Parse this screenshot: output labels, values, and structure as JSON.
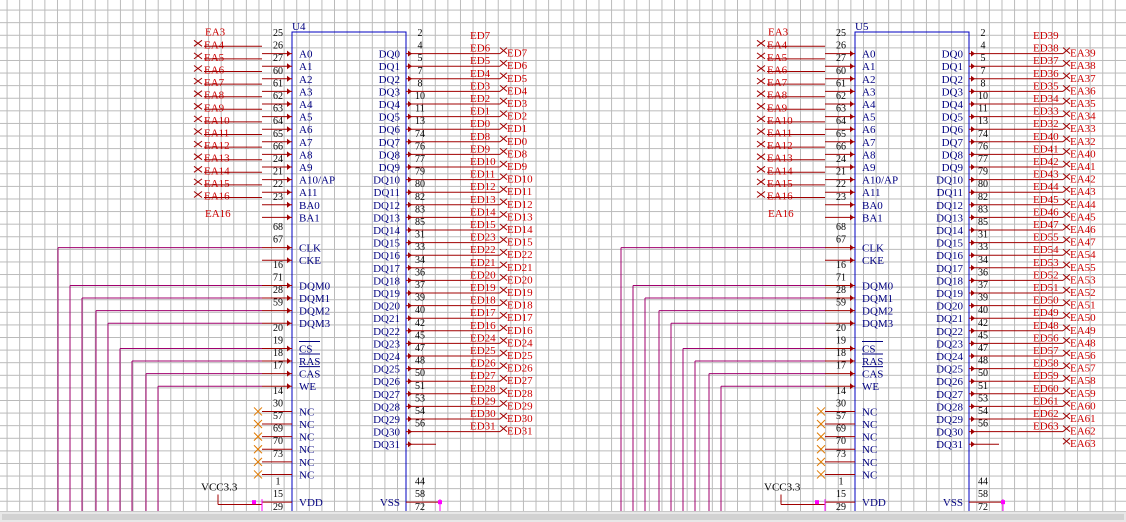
{
  "view": {
    "grid": true,
    "background": "#ffffff",
    "grid_color": "#b9b9b9"
  },
  "colors": {
    "wire": "#a00000",
    "label": "#cc0000",
    "body": "#0000c0",
    "pin_text": "#000080",
    "clock_wire": "#a0006e",
    "nc_mark": "#e07a00",
    "power_pin": "#ff00ff"
  },
  "power_label": "VCC3.3",
  "chips": [
    {
      "ref": "U4",
      "addr_nets": [
        "EA3",
        "EA4",
        "EA5",
        "EA6",
        "EA7",
        "EA8",
        "EA9",
        "EA10",
        "EA11",
        "EA12",
        "EA13",
        "EA14",
        "EA15",
        "EA16"
      ],
      "addr_extra_label": "EA16",
      "data_nets": [
        "ED7",
        "ED6",
        "ED5",
        "ED4",
        "ED3",
        "ED2",
        "ED1",
        "ED0",
        "ED8",
        "ED9",
        "ED10",
        "ED11",
        "ED12",
        "ED13",
        "ED14",
        "ED15",
        "ED23",
        "ED22",
        "ED21",
        "ED20",
        "ED19",
        "ED18",
        "ED17",
        "ED16",
        "ED24",
        "ED25",
        "ED26",
        "ED27",
        "ED28",
        "ED29",
        "ED30",
        "ED31"
      ],
      "data_side_labels": [
        "ED7",
        "ED6",
        "ED5",
        "ED4",
        "ED3",
        "ED2",
        "ED1",
        "ED0",
        "ED8",
        "ED9",
        "ED10",
        "ED11",
        "ED12",
        "ED13",
        "ED14",
        "ED15",
        "ED22",
        "ED21",
        "ED20",
        "ED19",
        "ED18",
        "ED17",
        "ED16",
        "ED24",
        "ED25",
        "ED26",
        "ED27",
        "ED28",
        "ED29",
        "ED30",
        "ED31"
      ]
    },
    {
      "ref": "U5",
      "addr_nets": [
        "EA3",
        "EA4",
        "EA5",
        "EA6",
        "EA7",
        "EA8",
        "EA9",
        "EA10",
        "EA11",
        "EA12",
        "EA13",
        "EA14",
        "EA15",
        "EA16"
      ],
      "addr_extra_label": "EA16",
      "data_nets": [
        "ED39",
        "ED38",
        "ED37",
        "ED36",
        "ED35",
        "ED34",
        "ED33",
        "ED32",
        "ED40",
        "ED41",
        "ED42",
        "ED43",
        "ED44",
        "ED45",
        "ED46",
        "ED47",
        "ED55",
        "ED54",
        "ED53",
        "ED52",
        "ED51",
        "ED50",
        "ED49",
        "ED48",
        "ED56",
        "ED57",
        "ED58",
        "ED59",
        "ED60",
        "ED61",
        "ED62",
        "ED63"
      ],
      "data_side_labels": [
        "EA39",
        "EA38",
        "EA37",
        "EA36",
        "EA35",
        "EA34",
        "EA33",
        "EA32",
        "EA40",
        "EA41",
        "EA42",
        "EA43",
        "EA44",
        "EA45",
        "EA46",
        "EA47",
        "EA54",
        "EA55",
        "EA53",
        "EA52",
        "EA51",
        "EA50",
        "EA49",
        "EA48",
        "EA56",
        "EA57",
        "EA58",
        "EA59",
        "EA60",
        "EA61",
        "EA62",
        "EA63"
      ]
    }
  ],
  "left_pins": [
    {
      "num": "25",
      "name": ""
    },
    {
      "num": "26",
      "name": "A0"
    },
    {
      "num": "27",
      "name": "A1"
    },
    {
      "num": "60",
      "name": "A2"
    },
    {
      "num": "61",
      "name": "A3"
    },
    {
      "num": "62",
      "name": "A4"
    },
    {
      "num": "63",
      "name": "A5"
    },
    {
      "num": "64",
      "name": "A6"
    },
    {
      "num": "65",
      "name": "A7"
    },
    {
      "num": "66",
      "name": "A8"
    },
    {
      "num": "24",
      "name": "A9"
    },
    {
      "num": "21",
      "name": "A10/AP"
    },
    {
      "num": "22",
      "name": "A11"
    },
    {
      "num": "23",
      "name": "BA0"
    },
    {
      "num": "",
      "name": "BA1"
    }
  ],
  "ctrl_pins": [
    {
      "num": "68",
      "name": ""
    },
    {
      "num": "67",
      "name": "CLK"
    },
    {
      "num": "",
      "name": "CKE"
    },
    {
      "num": "16",
      "name": ""
    },
    {
      "num": "71",
      "name": "DQM0"
    },
    {
      "num": "28",
      "name": "DQM1"
    },
    {
      "num": "59",
      "name": "DQM2"
    },
    {
      "num": "",
      "name": "DQM3"
    },
    {
      "num": "20",
      "name": ""
    },
    {
      "num": "19",
      "name": "CS"
    },
    {
      "num": "18",
      "name": "RAS"
    },
    {
      "num": "17",
      "name": "CAS"
    },
    {
      "num": "",
      "name": "WE"
    },
    {
      "num": "14",
      "name": ""
    },
    {
      "num": "30",
      "name": "NC"
    },
    {
      "num": "57",
      "name": "NC"
    },
    {
      "num": "69",
      "name": "NC"
    },
    {
      "num": "70",
      "name": "NC"
    },
    {
      "num": "73",
      "name": "NC"
    },
    {
      "num": "",
      "name": "NC"
    }
  ],
  "power_pins": [
    {
      "num": "1",
      "name": ""
    },
    {
      "num": "15",
      "name": "VDD"
    },
    {
      "num": "29",
      "name": "VDD"
    },
    {
      "num": "",
      "name": "VDD"
    }
  ],
  "right_pins": [
    {
      "num": "2",
      "name": ""
    },
    {
      "num": "4",
      "name": "DQ0"
    },
    {
      "num": "5",
      "name": "DQ1"
    },
    {
      "num": "7",
      "name": "DQ2"
    },
    {
      "num": "8",
      "name": "DQ3"
    },
    {
      "num": "10",
      "name": "DQ4"
    },
    {
      "num": "11",
      "name": "DQ5"
    },
    {
      "num": "13",
      "name": "DQ6"
    },
    {
      "num": "74",
      "name": "DQ7"
    },
    {
      "num": "76",
      "name": "DQ8"
    },
    {
      "num": "77",
      "name": "DQ9"
    },
    {
      "num": "79",
      "name": "DQ10"
    },
    {
      "num": "80",
      "name": "DQ11"
    },
    {
      "num": "82",
      "name": "DQ12"
    },
    {
      "num": "83",
      "name": "DQ13"
    },
    {
      "num": "85",
      "name": "DQ14"
    },
    {
      "num": "31",
      "name": "DQ15"
    },
    {
      "num": "33",
      "name": "DQ16"
    },
    {
      "num": "34",
      "name": "DQ17"
    },
    {
      "num": "36",
      "name": "DQ18"
    },
    {
      "num": "37",
      "name": "DQ19"
    },
    {
      "num": "39",
      "name": "DQ20"
    },
    {
      "num": "40",
      "name": "DQ21"
    },
    {
      "num": "42",
      "name": "DQ22"
    },
    {
      "num": "45",
      "name": "DQ23"
    },
    {
      "num": "47",
      "name": "DQ24"
    },
    {
      "num": "48",
      "name": "DQ25"
    },
    {
      "num": "50",
      "name": "DQ26"
    },
    {
      "num": "51",
      "name": "DQ27"
    },
    {
      "num": "53",
      "name": "DQ28"
    },
    {
      "num": "54",
      "name": "DQ29"
    },
    {
      "num": "56",
      "name": "DQ30"
    },
    {
      "num": "",
      "name": "DQ31"
    }
  ],
  "vss_pins": [
    {
      "num": "44",
      "name": ""
    },
    {
      "num": "58",
      "name": "VSS"
    },
    {
      "num": "72",
      "name": "VSS"
    },
    {
      "num": "",
      "name": "VSS"
    }
  ]
}
